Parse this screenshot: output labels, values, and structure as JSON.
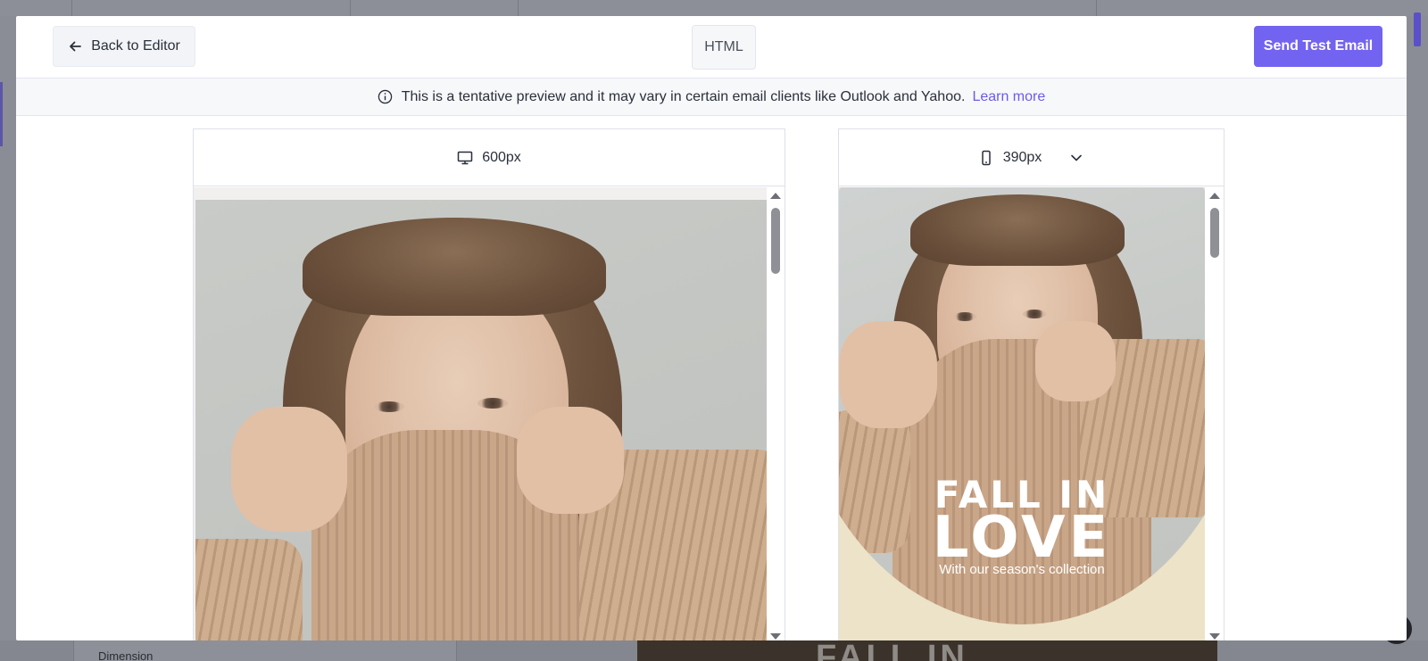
{
  "modal": {
    "back_label": "Back to Editor",
    "html_label": "HTML",
    "send_label": "Send Test Email"
  },
  "notice": {
    "text": "This is a tentative preview and it may vary in certain email clients like Outlook and Yahoo.",
    "link": "Learn more"
  },
  "desktop_preview": {
    "width_label": "600px",
    "icon": "monitor-icon"
  },
  "mobile_preview": {
    "width_label": "390px",
    "icon": "smartphone-icon",
    "headline_line1": "FALL IN",
    "headline_line2": "LOVE",
    "subline": "With our season's collection"
  },
  "background": {
    "panel_label": "Dimension",
    "banner_text": "FALL IN"
  },
  "colors": {
    "accent": "#7263f0",
    "link": "#6a5ce8",
    "cream": "#ece3c8"
  }
}
